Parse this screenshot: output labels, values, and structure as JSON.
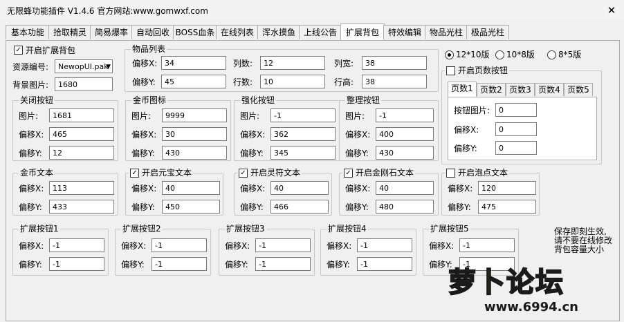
{
  "window": {
    "title": "无限蜂功能插件 V1.4.6  官方网站:www.gomwxf.com",
    "close": "✕"
  },
  "tabs": [
    "基本功能",
    "拾取精灵",
    "简易爆率",
    "自动回收",
    "BOSS血条",
    "在线列表",
    "浑水摸鱼",
    "上线公告",
    "扩展背包",
    "特效编辑",
    "物品光柱",
    "极品光柱"
  ],
  "active_tab": 8,
  "open_bag": {
    "label": "开启扩展背包",
    "checked": true,
    "resource_label": "资源编号:",
    "resource_value": "NewopUI.pak",
    "bg_label": "背景图片:",
    "bg_value": "1680"
  },
  "item_list": {
    "title": "物品列表",
    "offx_label": "偏移X:",
    "offx": "34",
    "offy_label": "偏移Y:",
    "offy": "45",
    "cols_label": "列数:",
    "cols": "12",
    "rows_label": "行数:",
    "rows": "10",
    "colw_label": "列宽:",
    "colw": "38",
    "rowh_label": "行高:",
    "rowh": "38"
  },
  "close_btn": {
    "title": "关闭按钮",
    "img_label": "图片:",
    "img": "1681",
    "x_label": "偏移X:",
    "x": "465",
    "y_label": "偏移Y:",
    "y": "12"
  },
  "gold_icon": {
    "title": "金币图标",
    "img_label": "图片:",
    "img": "9999",
    "x_label": "偏移X:",
    "x": "30",
    "y_label": "偏移Y:",
    "y": "430"
  },
  "enhance_btn": {
    "title": "强化按钮",
    "img_label": "图片:",
    "img": "-1",
    "x_label": "偏移X:",
    "x": "362",
    "y_label": "偏移Y:",
    "y": "345"
  },
  "sort_btn": {
    "title": "整理按钮",
    "img_label": "图片:",
    "img": "-1",
    "x_label": "偏移X:",
    "x": "400",
    "y_label": "偏移Y:",
    "y": "430"
  },
  "gold_text": {
    "title": "金币文本",
    "x_label": "偏移X:",
    "x": "113",
    "y_label": "偏移Y:",
    "y": "433"
  },
  "yuanbao_text": {
    "title": "开启元宝文本",
    "checked": true,
    "x_label": "偏移X:",
    "x": "40",
    "y_label": "偏移Y:",
    "y": "450"
  },
  "lingfu_text": {
    "title": "开启灵符文本",
    "checked": true,
    "x_label": "偏移X:",
    "x": "40",
    "y_label": "偏移Y:",
    "y": "466"
  },
  "diamond_text": {
    "title": "开启金刚石文本",
    "checked": true,
    "x_label": "偏移X:",
    "x": "40",
    "y_label": "偏移Y:",
    "y": "480"
  },
  "bubble_text": {
    "title": "开启泡点文本",
    "checked": false,
    "x_label": "偏移X:",
    "x": "120",
    "y_label": "偏移Y:",
    "y": "475"
  },
  "layout_options": {
    "options": [
      "12*10版",
      "10*8版",
      "8*5版"
    ],
    "selected": 0
  },
  "page_btn": {
    "title": "开启页数按钮",
    "checked": false,
    "subtabs": [
      "页数1",
      "页数2",
      "页数3",
      "页数4",
      "页数5"
    ],
    "active_subtab": 0,
    "img_label": "按钮图片:",
    "img": "0",
    "x_label": "偏移X:",
    "x": "0",
    "y_label": "偏移Y:",
    "y": "0"
  },
  "ext_btns": [
    {
      "title": "扩展按钮1",
      "x_label": "偏移X:",
      "x": "-1",
      "y_label": "偏移Y:",
      "y": "-1"
    },
    {
      "title": "扩展按钮2",
      "x_label": "偏移X:",
      "x": "-1",
      "y_label": "偏移Y:",
      "y": "-1"
    },
    {
      "title": "扩展按钮3",
      "x_label": "偏移X:",
      "x": "-1",
      "y_label": "偏移Y:",
      "y": "-1"
    },
    {
      "title": "扩展按钮4",
      "x_label": "偏移X:",
      "x": "-1",
      "y_label": "偏移Y:",
      "y": "-1"
    },
    {
      "title": "扩展按钮5",
      "x_label": "偏移X:",
      "x": "-1",
      "y_label": "偏移Y:",
      "y": "-1"
    }
  ],
  "note": [
    "保存即刻生效,",
    "请不要在线修改",
    "背包容量大小"
  ],
  "watermark": {
    "text": "萝卜论坛",
    "url": "www.6994.cn"
  }
}
